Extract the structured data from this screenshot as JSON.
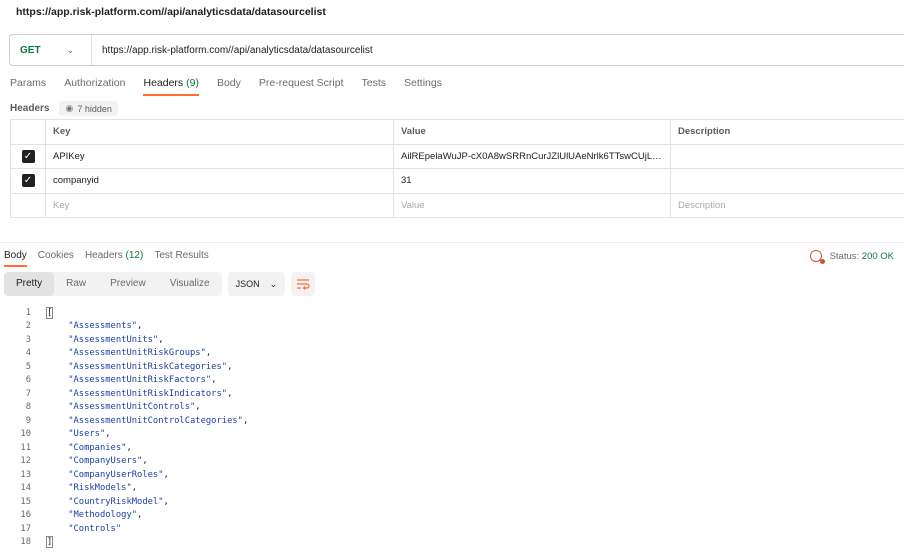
{
  "title": "https://app.risk-platform.com//api/analyticsdata/datasourcelist",
  "request": {
    "method": "GET",
    "url": "https://app.risk-platform.com//api/analyticsdata/datasourcelist"
  },
  "request_tabs": [
    {
      "label": "Params"
    },
    {
      "label": "Authorization"
    },
    {
      "label": "Headers",
      "count": "(9)"
    },
    {
      "label": "Body"
    },
    {
      "label": "Pre-request Script"
    },
    {
      "label": "Tests"
    },
    {
      "label": "Settings"
    }
  ],
  "headers_section": {
    "label": "Headers",
    "hidden_label": "7 hidden",
    "columns": {
      "key": "Key",
      "value": "Value",
      "description": "Description"
    },
    "rows": [
      {
        "key": "APIKey",
        "value": "AilREpelaWuJP-cX0A8wSRRnCurJZlUlUAeNrlk6TTswCUjLK...",
        "description": ""
      },
      {
        "key": "companyid",
        "value": "31",
        "description": ""
      }
    ],
    "placeholder": {
      "key": "Key",
      "value": "Value",
      "description": "Description"
    }
  },
  "response_tabs": [
    {
      "label": "Body"
    },
    {
      "label": "Cookies"
    },
    {
      "label": "Headers",
      "count": "(12)"
    },
    {
      "label": "Test Results"
    }
  ],
  "status": {
    "label": "Status:",
    "value": "200 OK"
  },
  "view_modes": [
    "Pretty",
    "Raw",
    "Preview",
    "Visualize"
  ],
  "format": "JSON",
  "code_lines": [
    "[",
    "\"Assessments\",",
    "\"AssessmentUnits\",",
    "\"AssessmentUnitRiskGroups\",",
    "\"AssessmentUnitRiskCategories\",",
    "\"AssessmentUnitRiskFactors\",",
    "\"AssessmentUnitRiskIndicators\",",
    "\"AssessmentUnitControls\",",
    "\"AssessmentUnitControlCategories\",",
    "\"Users\",",
    "\"Companies\",",
    "\"CompanyUsers\",",
    "\"CompanyUserRoles\",",
    "\"RiskModels\",",
    "\"CountryRiskModel\",",
    "\"Methodology\",",
    "\"Controls\"",
    "]"
  ],
  "colors": {
    "accent": "#ff6c37",
    "method": "#0b7a3c",
    "string": "#1a3fa8"
  }
}
